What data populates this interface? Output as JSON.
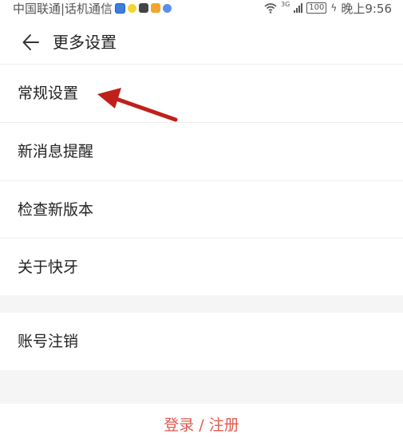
{
  "statusbar": {
    "carrier": "中国联通|话机通信",
    "battery": "100",
    "time": "晚上9:56",
    "network": "3G",
    "notification_icons": [
      "bulb-icon",
      "yellow-app-icon",
      "dark-app-icon",
      "orange-app-icon",
      "globe-icon"
    ]
  },
  "header": {
    "back_icon": "arrow-left-icon",
    "title": "更多设置"
  },
  "menu": {
    "items": [
      {
        "label": "常规设置"
      },
      {
        "label": "新消息提醒"
      },
      {
        "label": "检查新版本"
      },
      {
        "label": "关于快牙"
      }
    ],
    "account": {
      "label": "账号注销"
    }
  },
  "footer": {
    "login_label": "登录 / 注册"
  },
  "colors": {
    "accent": "#e05a4f",
    "annotation_arrow": "#c0201a",
    "section_gap": "#f5f5f5"
  }
}
